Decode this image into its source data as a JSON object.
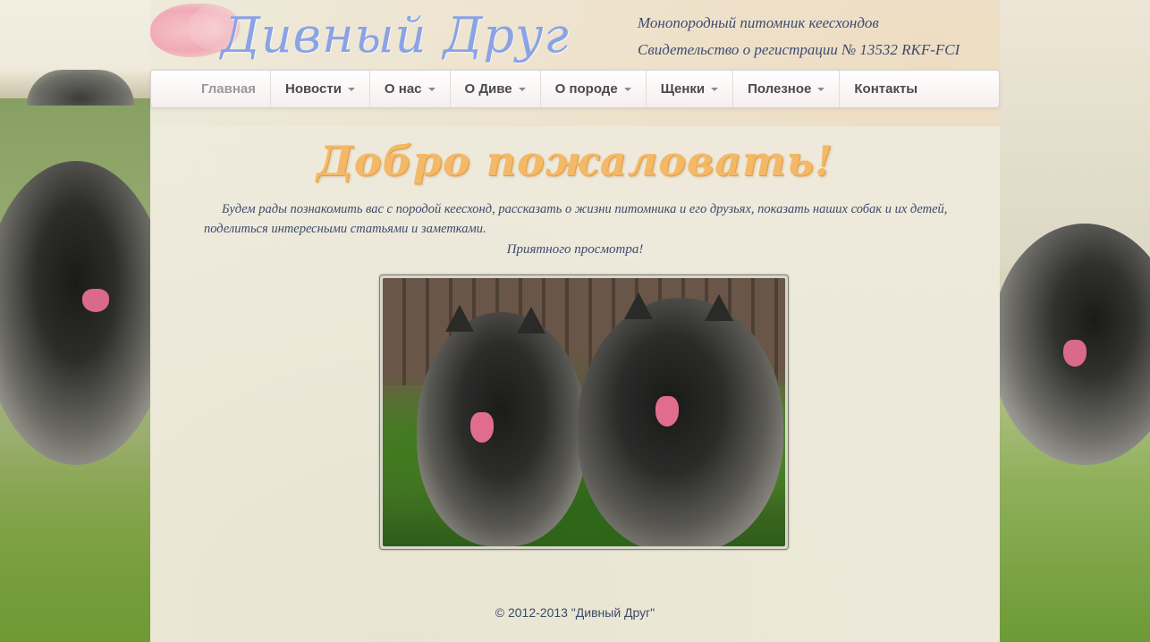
{
  "header": {
    "site_title": "Дивный Друг",
    "tagline_1": "Монопородный питомник кеесхондов",
    "tagline_2": "Свидетельство о регистрации № 13532 RKF-FCI"
  },
  "nav": {
    "items": [
      {
        "label": "Главная",
        "dropdown": false,
        "active": true
      },
      {
        "label": "Новости",
        "dropdown": true
      },
      {
        "label": "О нас",
        "dropdown": true
      },
      {
        "label": "О Диве",
        "dropdown": true
      },
      {
        "label": "О породе",
        "dropdown": true
      },
      {
        "label": "Щенки",
        "dropdown": true
      },
      {
        "label": "Полезное",
        "dropdown": true
      },
      {
        "label": "Контакты",
        "dropdown": false
      }
    ]
  },
  "main": {
    "welcome_heading": "Добро пожаловать!",
    "intro_text": "Будем рады познакомить вас с породой кеесхонд, рассказать о жизни питомника и его друзьях, показать наших собак и их детей, поделиться интересными статьями и заметками.",
    "enjoy_text": "Приятного просмотра!",
    "photo_icon": "keeshond-dogs-photo"
  },
  "footer": {
    "copyright": "© 2012-2013 \"Дивный Друг\""
  },
  "colors": {
    "title_blue": "#8aa3e6",
    "welcome_orange": "#f3b968",
    "text_navy": "#3d4b6d",
    "nav_text": "#4a4a4a",
    "nav_active": "#9a9a9a"
  }
}
